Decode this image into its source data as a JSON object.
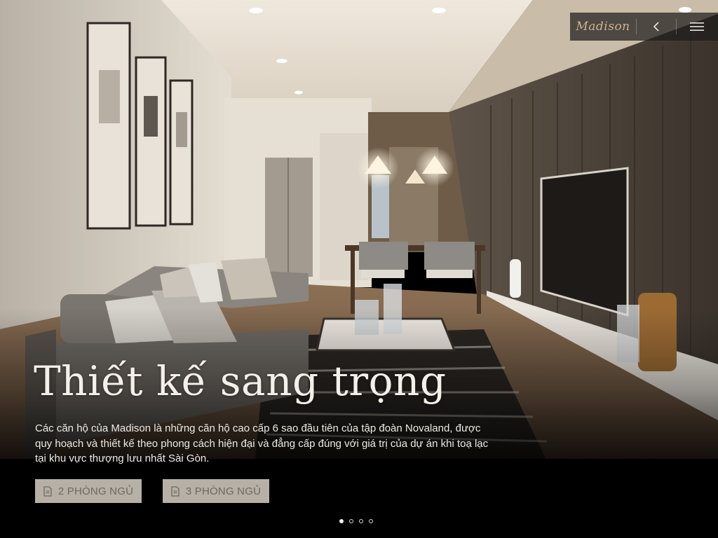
{
  "header": {
    "logo_text": "Madison",
    "back_label": "<",
    "menu_icon": "hamburger-menu-icon"
  },
  "hero": {
    "title": "Thiết kế sang trọng",
    "description": "Các căn hộ của Madison là những căn hộ cao cấp 6 sao đầu tiên của tập đoàn Novaland, được quy hoạch và thiết kế theo phong cách hiện đại và đẳng cấp đúng với giá trị của dự án khi toạ lạc tại khu vực thượng lưu nhất Sài Gòn."
  },
  "buttons": [
    {
      "label": "2 PHÒNG NGỦ",
      "icon": "document-icon"
    },
    {
      "label": "3 PHÒNG NGỦ",
      "icon": "document-icon"
    }
  ],
  "carousel": {
    "slide_count": 4,
    "active_index": 0
  },
  "colors": {
    "logo": "#cbb48f",
    "button_bg": "#b7b0a7",
    "button_text": "#6e6860",
    "overlay": "#000000"
  }
}
